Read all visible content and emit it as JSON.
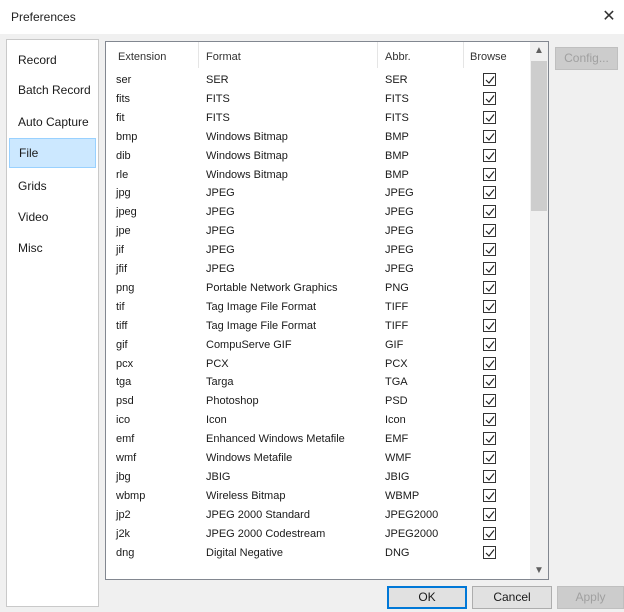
{
  "window": {
    "title": "Preferences",
    "close_glyph": "✕"
  },
  "nav": {
    "items": [
      {
        "label": "Record",
        "selected": false
      },
      {
        "label": "Batch Record",
        "selected": false
      },
      {
        "label": "Auto Capture",
        "selected": false
      },
      {
        "label": "File",
        "selected": true
      },
      {
        "label": "Grids",
        "selected": false
      },
      {
        "label": "Video",
        "selected": false
      },
      {
        "label": "Misc",
        "selected": false
      }
    ]
  },
  "list": {
    "columns": [
      "Extension",
      "Format",
      "Abbr.",
      "Browse"
    ],
    "rows": [
      {
        "ext": "ser",
        "format": "SER",
        "abbr": "SER",
        "browse": true
      },
      {
        "ext": "fits",
        "format": "FITS",
        "abbr": "FITS",
        "browse": true
      },
      {
        "ext": "fit",
        "format": "FITS",
        "abbr": "FITS",
        "browse": true
      },
      {
        "ext": "bmp",
        "format": "Windows Bitmap",
        "abbr": "BMP",
        "browse": true
      },
      {
        "ext": "dib",
        "format": "Windows Bitmap",
        "abbr": "BMP",
        "browse": true
      },
      {
        "ext": "rle",
        "format": "Windows Bitmap",
        "abbr": "BMP",
        "browse": true
      },
      {
        "ext": "jpg",
        "format": "JPEG",
        "abbr": "JPEG",
        "browse": true
      },
      {
        "ext": "jpeg",
        "format": "JPEG",
        "abbr": "JPEG",
        "browse": true
      },
      {
        "ext": "jpe",
        "format": "JPEG",
        "abbr": "JPEG",
        "browse": true
      },
      {
        "ext": "jif",
        "format": "JPEG",
        "abbr": "JPEG",
        "browse": true
      },
      {
        "ext": "jfif",
        "format": "JPEG",
        "abbr": "JPEG",
        "browse": true
      },
      {
        "ext": "png",
        "format": "Portable Network Graphics",
        "abbr": "PNG",
        "browse": true
      },
      {
        "ext": "tif",
        "format": "Tag Image File Format",
        "abbr": "TIFF",
        "browse": true
      },
      {
        "ext": "tiff",
        "format": "Tag Image File Format",
        "abbr": "TIFF",
        "browse": true
      },
      {
        "ext": "gif",
        "format": "CompuServe GIF",
        "abbr": "GIF",
        "browse": true
      },
      {
        "ext": "pcx",
        "format": "PCX",
        "abbr": "PCX",
        "browse": true
      },
      {
        "ext": "tga",
        "format": "Targa",
        "abbr": "TGA",
        "browse": true
      },
      {
        "ext": "psd",
        "format": "Photoshop",
        "abbr": "PSD",
        "browse": true
      },
      {
        "ext": "ico",
        "format": "Icon",
        "abbr": "Icon",
        "browse": true
      },
      {
        "ext": "emf",
        "format": "Enhanced Windows Metafile",
        "abbr": "EMF",
        "browse": true
      },
      {
        "ext": "wmf",
        "format": "Windows Metafile",
        "abbr": "WMF",
        "browse": true
      },
      {
        "ext": "jbg",
        "format": "JBIG",
        "abbr": "JBIG",
        "browse": true
      },
      {
        "ext": "wbmp",
        "format": "Wireless Bitmap",
        "abbr": "WBMP",
        "browse": true
      },
      {
        "ext": "jp2",
        "format": "JPEG 2000 Standard",
        "abbr": "JPEG2000",
        "browse": true
      },
      {
        "ext": "j2k",
        "format": "JPEG 2000 Codestream",
        "abbr": "JPEG2000",
        "browse": true
      },
      {
        "ext": "dng",
        "format": "Digital Negative",
        "abbr": "DNG",
        "browse": true
      }
    ]
  },
  "buttons": {
    "config": "Config...",
    "ok": "OK",
    "cancel": "Cancel",
    "apply": "Apply"
  },
  "icons": {
    "close": "close-icon",
    "scroll_up": "chevron-up-icon",
    "scroll_down": "chevron-down-icon",
    "check": "checkmark-icon"
  },
  "colors": {
    "selection_bg": "#cce8ff",
    "selection_border": "#99d1ff",
    "default_button_border": "#0078d7",
    "dialog_bg": "#f0f0f0"
  }
}
